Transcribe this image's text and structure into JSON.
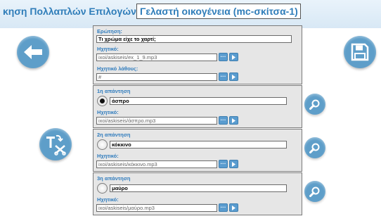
{
  "header": {
    "title": "κηση Πολλαπλών Επιλογών:",
    "exercise_name": "Γελαστή οικογένεια (mc-σκίτσα-1)"
  },
  "question": {
    "label": "Ερώτηση:",
    "text": "Τι χρώμα είχε το χαρτί;",
    "audio_label": "Ηχητικό:",
    "audio_file": "ixoi/askiseis/ex_1_9.mp3",
    "wrong_audio_label": "Ηχητικό λάθους:",
    "wrong_audio_file": "#"
  },
  "answers": [
    {
      "title": "1η απάντηση",
      "text": "άσπρο",
      "selected": true,
      "audio_label": "Ηχητικό:",
      "audio_file": "ixoi/askiseis/άσπρο.mp3"
    },
    {
      "title": "2η απάντηση",
      "text": "κόκκινο",
      "selected": false,
      "audio_label": "Ηχητικό:",
      "audio_file": "ixoi/askiseis/κόκκινο.mp3"
    },
    {
      "title": "3η απάντηση",
      "text": "μαύρο",
      "selected": false,
      "audio_label": "Ηχητικό:",
      "audio_file": "ixoi/askiseis/μαύρο.mp3"
    }
  ],
  "icons": {
    "back": "back-arrow-icon",
    "save": "floppy-disk-icon",
    "tool": "text-tool-icon",
    "browse": "ellipsis-icon",
    "play": "play-icon",
    "search": "magnifier-icon"
  },
  "colors": {
    "accent": "#2f7db9",
    "button": "#5e9ec9",
    "panel": "#e6e6e6"
  }
}
